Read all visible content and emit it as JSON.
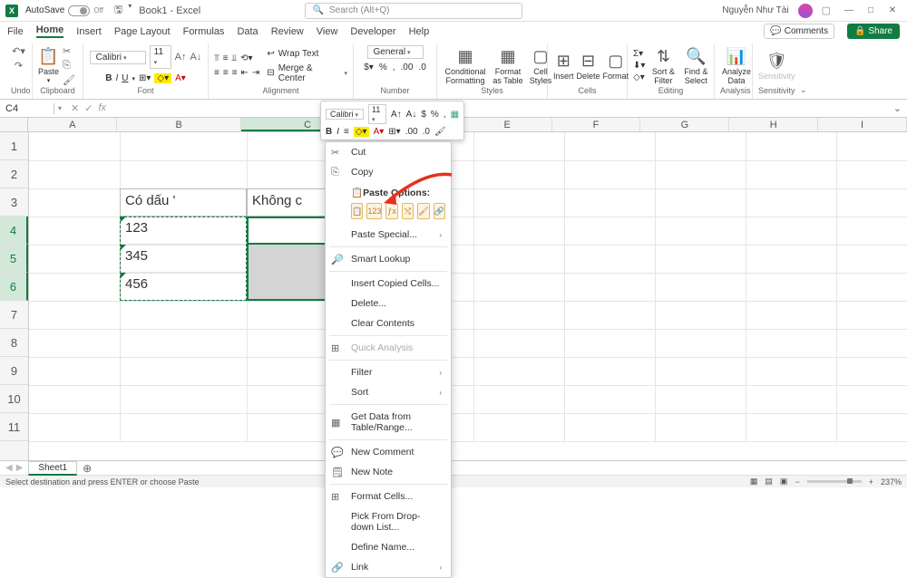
{
  "title": {
    "autosave": "AutoSave",
    "autosave_off": "Off",
    "file": "Book1 - Excel",
    "search": "Search (Alt+Q)",
    "user": "Nguyễn Như Tài"
  },
  "menu": {
    "file": "File",
    "home": "Home",
    "insert": "Insert",
    "page_layout": "Page Layout",
    "formulas": "Formulas",
    "data": "Data",
    "review": "Review",
    "view": "View",
    "developer": "Developer",
    "help": "Help",
    "comments": "Comments",
    "share": "Share"
  },
  "ribbon": {
    "undo": "Undo",
    "clipboard": "Clipboard",
    "paste": "Paste",
    "font": "Font",
    "font_name": "Calibri",
    "font_size": "11",
    "alignment": "Alignment",
    "wrap": "Wrap Text",
    "merge": "Merge & Center",
    "number": "Number",
    "number_fmt": "General",
    "styles": "Styles",
    "cond_fmt": "Conditional Formatting",
    "fmt_table": "Format as Table",
    "cell_styles": "Cell Styles",
    "cells": "Cells",
    "insert": "Insert",
    "delete": "Delete",
    "format": "Format",
    "editing": "Editing",
    "sort": "Sort & Filter",
    "find": "Find & Select",
    "analysis": "Analysis",
    "analyze": "Analyze Data",
    "sensitivity": "Sensitivity",
    "sens_btn": "Sensitivity"
  },
  "formula": {
    "cell_ref": "C4"
  },
  "columns": [
    "A",
    "B",
    "C",
    "D",
    "E",
    "F",
    "G",
    "H",
    "I"
  ],
  "rows": [
    "1",
    "2",
    "3",
    "4",
    "5",
    "6",
    "7",
    "8",
    "9",
    "10",
    "11"
  ],
  "cells": {
    "b3": "Có dấu '",
    "c3": "Không c",
    "b4": "123",
    "b5": "345",
    "b6": "456"
  },
  "mini": {
    "font": "Calibri",
    "size": "11"
  },
  "context": {
    "cut": "Cut",
    "copy": "Copy",
    "paste_opts": "Paste Options:",
    "paste_special": "Paste Special...",
    "smart_lookup": "Smart Lookup",
    "insert_copied": "Insert Copied Cells...",
    "delete": "Delete...",
    "clear": "Clear Contents",
    "quick": "Quick Analysis",
    "filter": "Filter",
    "sort": "Sort",
    "get_data": "Get Data from Table/Range...",
    "new_comment": "New Comment",
    "new_note": "New Note",
    "format_cells": "Format Cells...",
    "pick": "Pick From Drop-down List...",
    "define": "Define Name...",
    "link": "Link"
  },
  "sheet": {
    "name": "Sheet1"
  },
  "status": {
    "text": "Select destination and press ENTER or choose Paste",
    "zoom": "237%"
  }
}
